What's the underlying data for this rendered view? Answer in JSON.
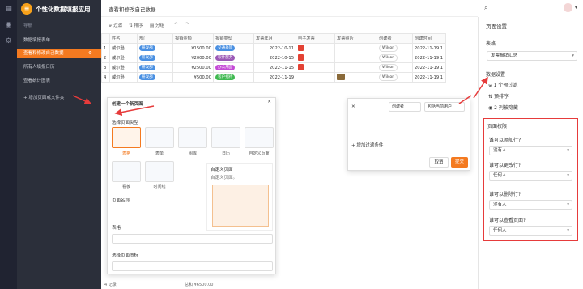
{
  "app": {
    "title": "个性化数据填报应用",
    "logo_glyph": "≡"
  },
  "rail": {
    "icons": [
      "grid-icon",
      "eye-icon",
      "settings-icon"
    ]
  },
  "sidebar": {
    "section": "导航",
    "items": [
      {
        "label": "数据填报表单",
        "active": false
      },
      {
        "label": "查看和修改自己数据",
        "active": true
      },
      {
        "label": "所有人填报日历",
        "active": false
      },
      {
        "label": "查看统计图表",
        "active": false
      }
    ],
    "add_label": "+ 增加页面或文件夹"
  },
  "topbar": {
    "title": "查看和修改自己数据"
  },
  "toolbar": {
    "filter": "过滤",
    "sort": "排序",
    "group": "分组",
    "undo": "↶",
    "redo": "↷"
  },
  "table": {
    "columns": [
      "",
      "姓名",
      "部门",
      "报销金额",
      "报销类型",
      "发票年月",
      "电子发票",
      "发票照片",
      "创建者",
      "创建时间"
    ],
    "rows": [
      {
        "n": "1",
        "name": "戚尔逊",
        "dept": "研发部",
        "amount": "¥1500.00",
        "type": "交通差旅",
        "type_color": "#4a90e2",
        "date": "2022-10-11",
        "pdf": true,
        "photo": false,
        "creator": "Wilson",
        "created": "2022-11-19 1"
      },
      {
        "n": "2",
        "name": "戚尔逊",
        "dept": "研发部",
        "amount": "¥2000.00",
        "type": "软件服务",
        "type_color": "#9b59b6",
        "date": "2022-10-15",
        "pdf": true,
        "photo": false,
        "creator": "Wilson",
        "created": "2022-11-19 1"
      },
      {
        "n": "3",
        "name": "戚尔逊",
        "dept": "研发部",
        "amount": "¥2500.00",
        "type": "办公用品",
        "type_color": "#c44ad6",
        "date": "2022-11-15",
        "pdf": true,
        "photo": false,
        "creator": "Wilson",
        "created": "2022-11-19 1"
      },
      {
        "n": "4",
        "name": "戚尔逊",
        "dept": "研发部",
        "amount": "¥500.00",
        "type": "客户招待",
        "type_color": "#3fb950",
        "date": "2022-11-19",
        "pdf": false,
        "photo": true,
        "creator": "Wilson",
        "created": "2022-11-19 1"
      }
    ]
  },
  "footer": {
    "count": "4 记录",
    "sum": "总和 ¥6500.00"
  },
  "right_panel": {
    "title": "页面设置",
    "table_label": "表格",
    "table_value": "发票报销汇总",
    "data_label": "数据设置",
    "filter": "1 个预过滤",
    "sort": "预排序",
    "hidden": "2 列被隐藏",
    "perm_title": "页面权限",
    "q_add": "谁可以添加行?",
    "a_add": "没有人",
    "q_edit": "谁可以更改行?",
    "a_edit": "任何人",
    "q_del": "谁可以删除行?",
    "a_del": "没有人",
    "q_view": "谁可以查看页面?",
    "a_view": "任何人"
  },
  "dialog1": {
    "title": "创建一个新页面",
    "type_label": "选择页面类型",
    "types": [
      "表格",
      "表单",
      "图库",
      "日历",
      "自定义页面",
      "看板",
      "时间线"
    ],
    "custom_title": "自定义页面",
    "custom_desc": "自定义页面。",
    "name_label": "页面名称",
    "table_label": "表格",
    "icon_label": "选择页面图标"
  },
  "dialog2": {
    "creator": "创建者",
    "op": "包括当前用户",
    "add_cond": "增加过滤条件",
    "cancel": "取消",
    "submit": "提交"
  },
  "colors": {
    "accent": "#f47a20",
    "red": "#e63b3b",
    "dept": "#4a90e2"
  }
}
